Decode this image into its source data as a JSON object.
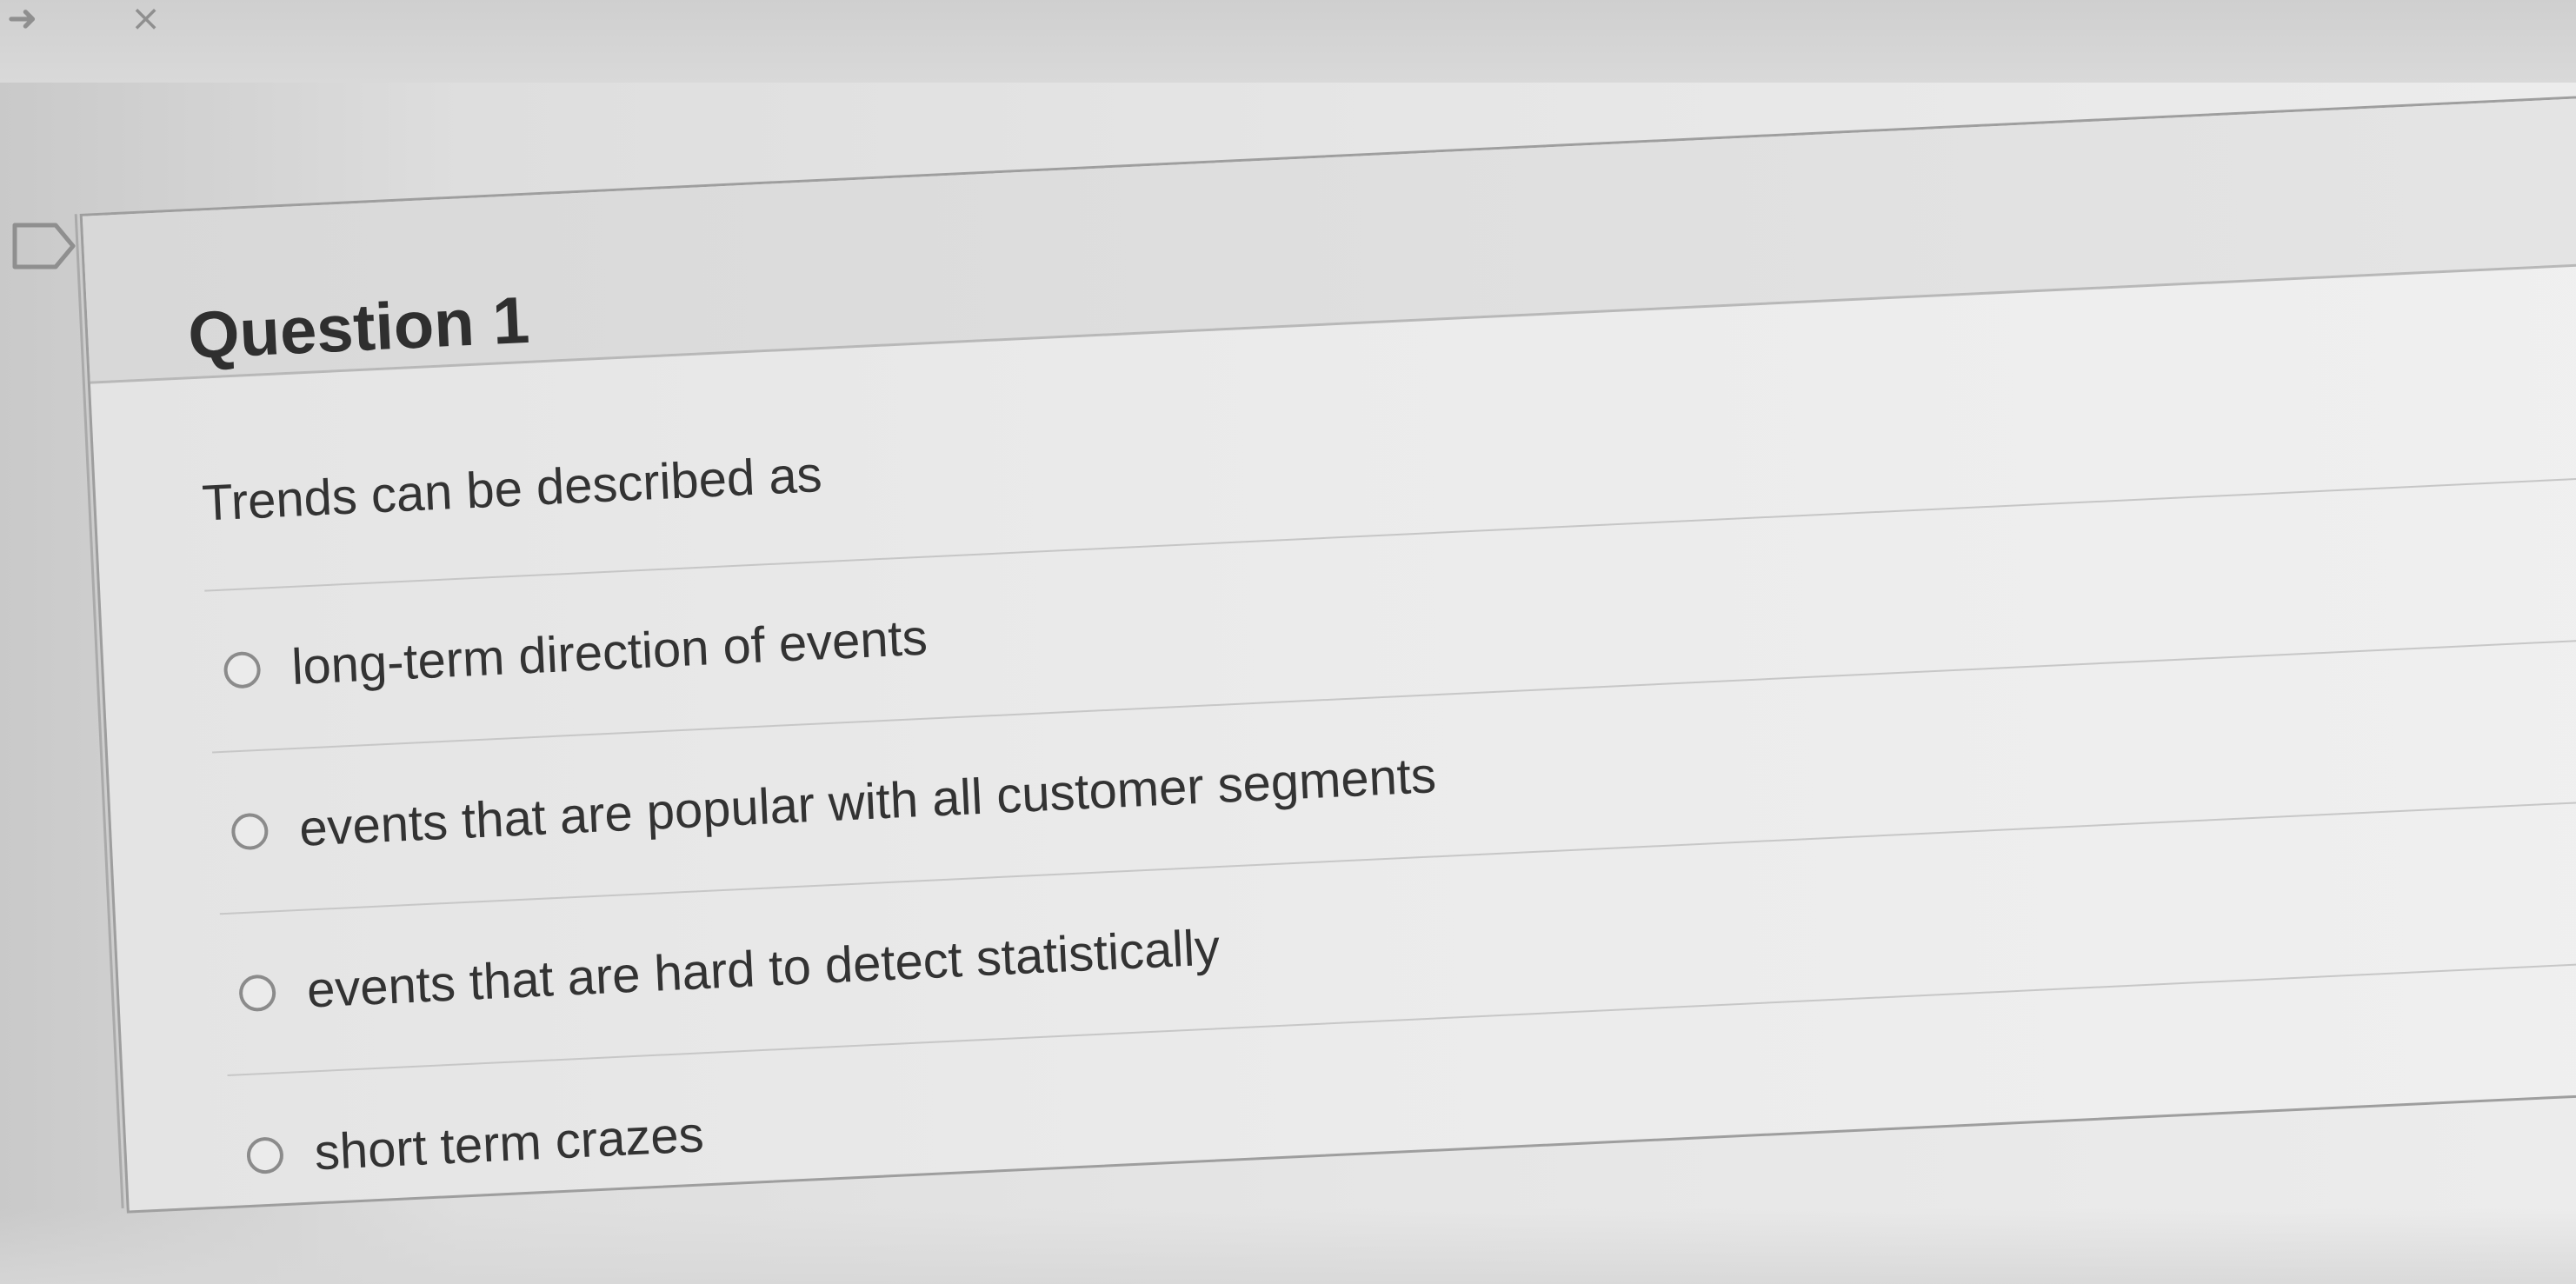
{
  "page": {
    "background_color": "#d6d6d6",
    "text_color": "#333333"
  },
  "chrome": {
    "top_icons": {
      "arrow": "arrow-icon",
      "close": "close-icon"
    }
  },
  "question": {
    "flag_icon": "flag-icon",
    "title": "Question 1",
    "text": "Trends can be described as",
    "options": [
      {
        "label": "long-term direction of events",
        "selected": false
      },
      {
        "label": "events that are popular with all customer segments",
        "selected": false
      },
      {
        "label": "events that are hard to detect statistically",
        "selected": false
      },
      {
        "label": "short term crazes",
        "selected": false
      }
    ]
  }
}
